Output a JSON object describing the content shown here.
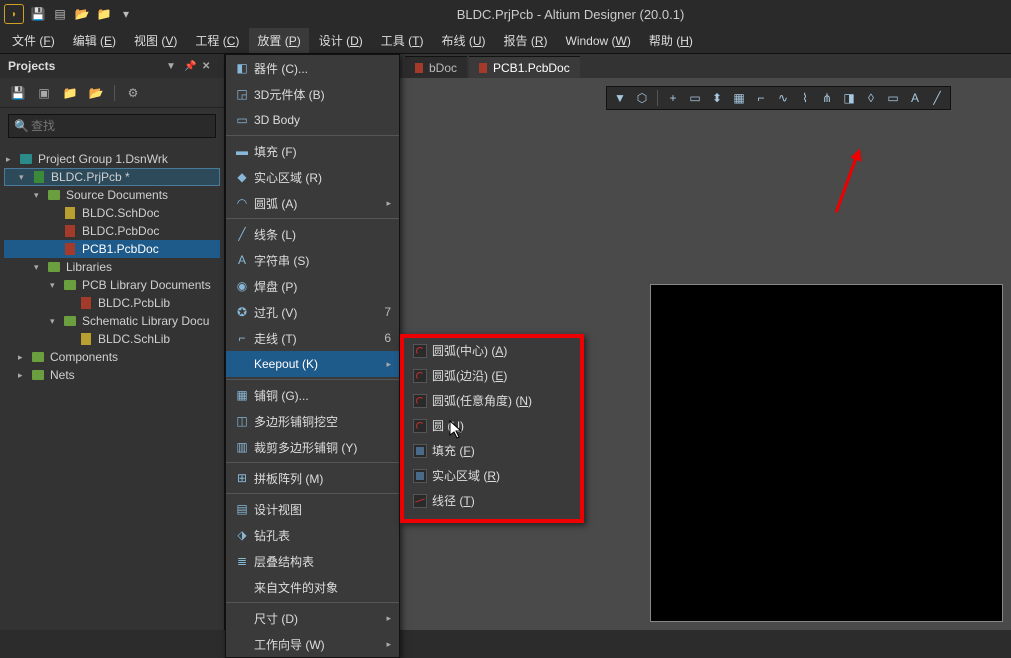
{
  "app": {
    "title": "BLDC.PrjPcb - Altium Designer (20.0.1)"
  },
  "menubar": [
    {
      "label": "文件",
      "key": "F"
    },
    {
      "label": "编辑",
      "key": "E"
    },
    {
      "label": "视图",
      "key": "V"
    },
    {
      "label": "工程",
      "key": "C"
    },
    {
      "label": "放置",
      "key": "P",
      "open": true
    },
    {
      "label": "设计",
      "key": "D"
    },
    {
      "label": "工具",
      "key": "T"
    },
    {
      "label": "布线",
      "key": "U"
    },
    {
      "label": "报告",
      "key": "R"
    },
    {
      "label": "Window",
      "key": "W"
    },
    {
      "label": "帮助",
      "key": "H"
    }
  ],
  "projects": {
    "title": "Projects",
    "search_placeholder": "查找",
    "tree": [
      {
        "depth": 0,
        "type": "group",
        "label": "Project Group 1.DsnWrk",
        "arrow": "▸",
        "icon": "folder-teal"
      },
      {
        "depth": 1,
        "type": "proj",
        "label": "BLDC.PrjPcb *",
        "arrow": "▾",
        "icon": "doc-grn",
        "projroot": true
      },
      {
        "depth": 2,
        "type": "folder",
        "label": "Source Documents",
        "arrow": "▾",
        "icon": "folder"
      },
      {
        "depth": 3,
        "type": "doc",
        "label": "BLDC.SchDoc",
        "icon": "doc-yel"
      },
      {
        "depth": 3,
        "type": "doc",
        "label": "BLDC.PcbDoc",
        "icon": "doc-red"
      },
      {
        "depth": 3,
        "type": "doc",
        "label": "PCB1.PcbDoc",
        "icon": "doc-red",
        "selected": true
      },
      {
        "depth": 2,
        "type": "folder",
        "label": "Libraries",
        "arrow": "▾",
        "icon": "folder"
      },
      {
        "depth": 3,
        "type": "folder",
        "label": "PCB Library Documents",
        "arrow": "▾",
        "icon": "folder"
      },
      {
        "depth": 4,
        "type": "doc",
        "label": "BLDC.PcbLib",
        "icon": "doc-red"
      },
      {
        "depth": 3,
        "type": "folder",
        "label": "Schematic Library Docu",
        "arrow": "▾",
        "icon": "folder"
      },
      {
        "depth": 4,
        "type": "doc",
        "label": "BLDC.SchLib",
        "icon": "doc-yel"
      },
      {
        "depth": 1,
        "type": "folder",
        "label": "Components",
        "arrow": "▸",
        "icon": "folder"
      },
      {
        "depth": 1,
        "type": "folder",
        "label": "Nets",
        "arrow": "▸",
        "icon": "folder"
      }
    ]
  },
  "tabs": [
    {
      "label": "bDoc",
      "active": false
    },
    {
      "label": "PCB1.PcbDoc",
      "active": true
    }
  ],
  "place_menu": [
    {
      "label": "器件 (C)...",
      "icon": "◧"
    },
    {
      "label": "3D元件体 (B)",
      "icon": "◲"
    },
    {
      "label": "3D Body",
      "icon": "▭"
    },
    {
      "sep": true
    },
    {
      "label": "填充 (F)",
      "icon": "▬"
    },
    {
      "label": "实心区域 (R)",
      "icon": "◆"
    },
    {
      "label": "圆弧 (A)",
      "icon": "◠",
      "sub": true
    },
    {
      "sep": true
    },
    {
      "label": "线条 (L)",
      "icon": "╱"
    },
    {
      "label": "字符串 (S)",
      "icon": "A"
    },
    {
      "label": "焊盘 (P)",
      "icon": "◉"
    },
    {
      "label": "过孔 (V)",
      "icon": "✪",
      "shortcut": "7"
    },
    {
      "label": "走线 (T)",
      "icon": "⌐",
      "shortcut": "6"
    },
    {
      "label": "Keepout (K)",
      "icon": "",
      "sub": true,
      "hover": true
    },
    {
      "sep": true
    },
    {
      "label": "铺铜 (G)...",
      "icon": "▦"
    },
    {
      "label": "多边形铺铜挖空",
      "icon": "◫"
    },
    {
      "label": "裁剪多边形铺铜 (Y)",
      "icon": "▥"
    },
    {
      "sep": true
    },
    {
      "label": "拼板阵列 (M)",
      "icon": "⊞"
    },
    {
      "sep": true
    },
    {
      "label": "设计视图",
      "icon": "▤"
    },
    {
      "label": "钻孔表",
      "icon": "⬗"
    },
    {
      "label": "层叠结构表",
      "icon": "≣"
    },
    {
      "label": "来自文件的对象",
      "icon": ""
    },
    {
      "sep": true
    },
    {
      "label": "尺寸 (D)",
      "icon": "",
      "sub": true
    },
    {
      "label": "工作向导 (W)",
      "icon": "",
      "sub": true
    }
  ],
  "keepout_submenu": [
    {
      "label": "圆弧(中心) (A)",
      "icon": "arc"
    },
    {
      "label": "圆弧(边沿) (E)",
      "icon": "arc"
    },
    {
      "label": "圆弧(任意角度) (N)",
      "icon": "arc"
    },
    {
      "label": "圆 (U)",
      "icon": "arc"
    },
    {
      "label": "填充 (F)",
      "icon": "sq"
    },
    {
      "label": "实心区域 (R)",
      "icon": "sq"
    },
    {
      "label": "线径 (T)",
      "icon": "line"
    }
  ],
  "editor_toolbar": [
    "▼",
    "⬡",
    "|",
    "+",
    "▭",
    "⬍",
    "▦",
    "⌐",
    "∿",
    "⌇",
    "⋔",
    "◨",
    "◊",
    "▭",
    "A",
    "╱"
  ]
}
